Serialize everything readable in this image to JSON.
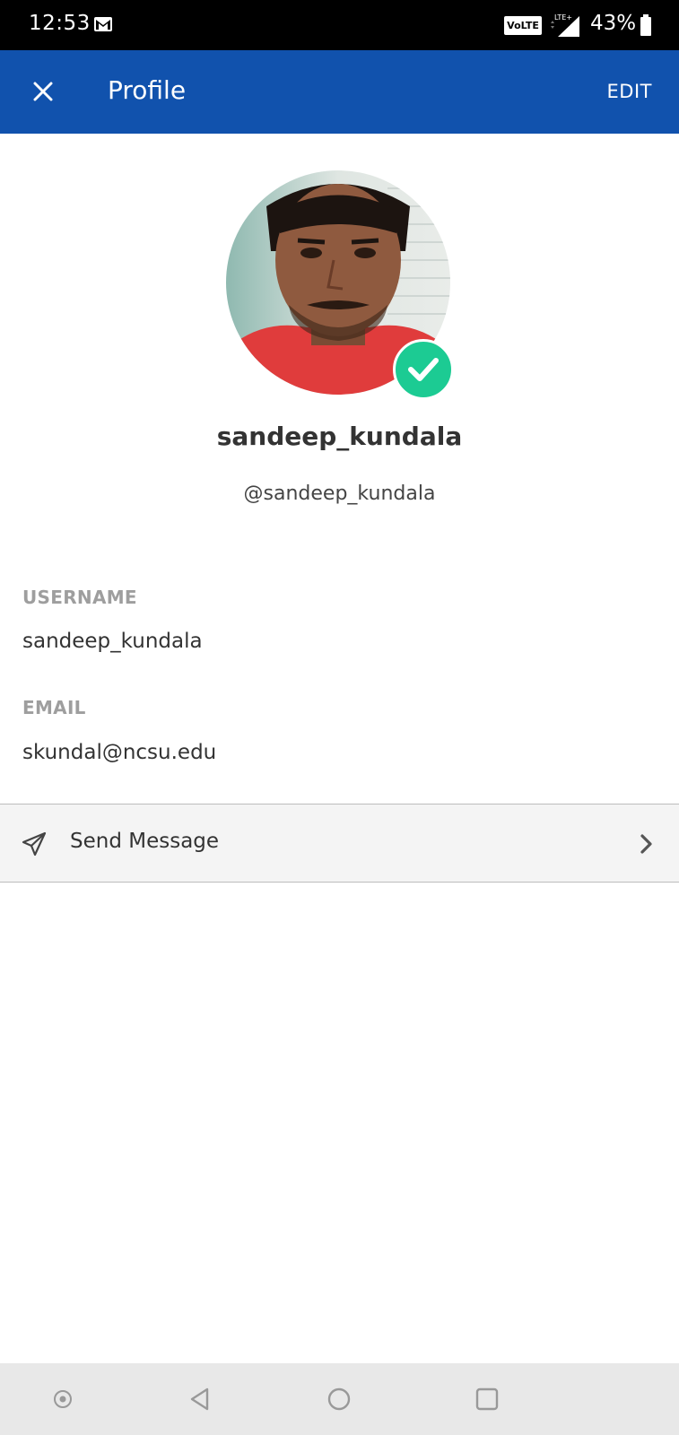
{
  "status_bar": {
    "time": "12:53",
    "network_badge": "VoLTE",
    "battery_percent": "43%",
    "icons": [
      "gmail-icon",
      "signal-icon",
      "battery-icon"
    ]
  },
  "app_bar": {
    "title": "Profile",
    "edit_label": "EDIT",
    "background_color": "#1152ad"
  },
  "profile": {
    "display_name": "sandeep_kundala",
    "handle": "@sandeep_kundala",
    "verified": true,
    "badge_color": "#1ccb93"
  },
  "fields": {
    "username_label": "USERNAME",
    "username_value": "sandeep_kundala",
    "email_label": "EMAIL",
    "email_value": "skundal@ncsu.edu"
  },
  "actions": {
    "send_message_label": "Send Message"
  },
  "nav_bar": {
    "items": [
      "assistant-icon",
      "back-icon",
      "home-icon",
      "recents-icon"
    ]
  }
}
